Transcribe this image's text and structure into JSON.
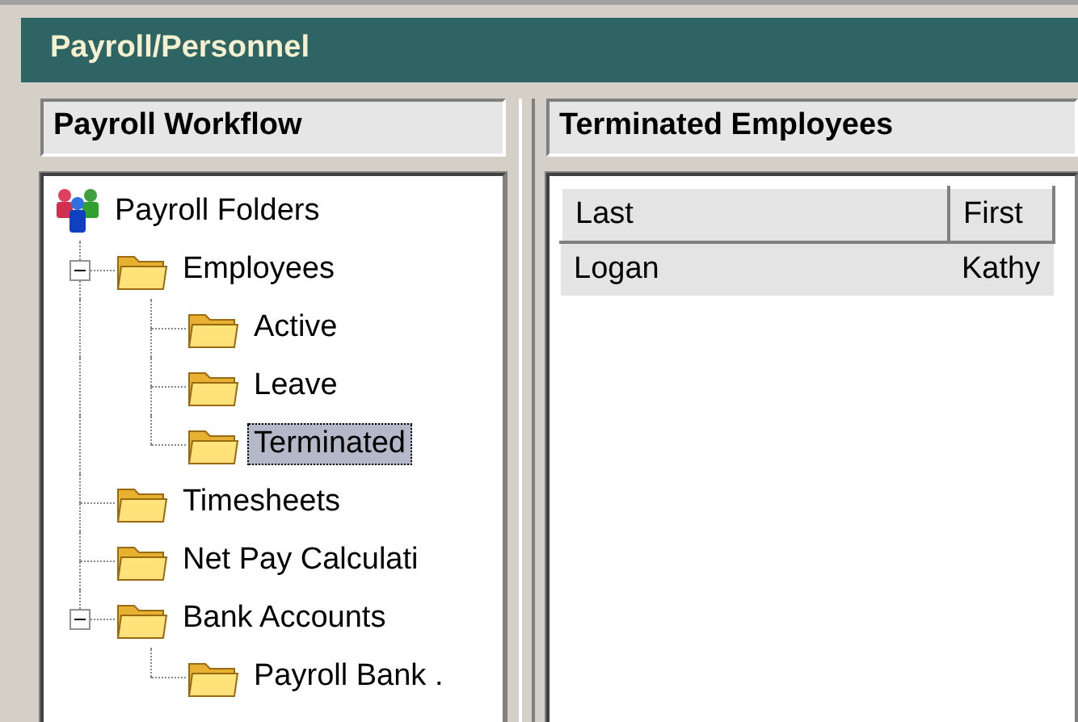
{
  "window": {
    "title": "Payroll/Personnel"
  },
  "workflow": {
    "title": "Payroll Workflow",
    "tree": [
      {
        "label": "Payroll Folders",
        "kind": "group",
        "selected": false,
        "children": [
          {
            "label": "Employees",
            "kind": "folder",
            "selected": false,
            "expanded": true,
            "children": [
              {
                "label": "Active",
                "kind": "folder",
                "selected": false
              },
              {
                "label": "Leave",
                "kind": "folder",
                "selected": false
              },
              {
                "label": "Terminated",
                "kind": "folder",
                "selected": true
              }
            ]
          },
          {
            "label": "Timesheets",
            "kind": "folder",
            "selected": false
          },
          {
            "label": "Net Pay Calculati",
            "kind": "folder",
            "selected": false
          },
          {
            "label": "Bank Accounts",
            "kind": "folder",
            "selected": false,
            "expanded": true,
            "children": [
              {
                "label": "Payroll Bank .",
                "kind": "folder",
                "selected": false
              }
            ]
          }
        ]
      }
    ]
  },
  "list": {
    "title": "Terminated Employees",
    "columns": [
      "Last",
      "First"
    ],
    "rows": [
      {
        "cells": [
          "Logan",
          "Kathy"
        ],
        "selected": true
      }
    ]
  }
}
